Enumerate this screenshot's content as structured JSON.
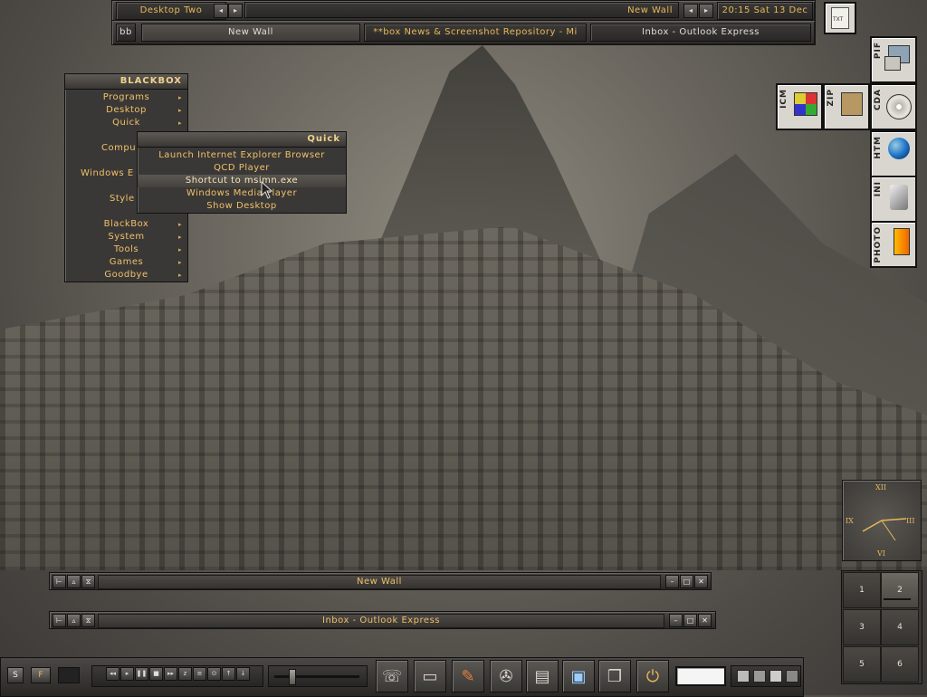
{
  "toolbar": {
    "workspace": "Desktop Two",
    "window": "New Wall",
    "clock": "20:15 Sat 13 Dec"
  },
  "iconbar": {
    "bb": "bb",
    "tasks": [
      "New Wall",
      "**box News & Screenshot Repository - Mi",
      "Inbox - Outlook Express"
    ]
  },
  "root_menu": {
    "title": "BLACKBOX",
    "items": [
      "Programs",
      "Desktop",
      "Quick",
      "",
      "Compu",
      "",
      "Windows E",
      "",
      "Style",
      "",
      "BlackBox",
      "System",
      "Tools",
      "Games",
      "Goodbye"
    ]
  },
  "quick_menu": {
    "title": "Quick",
    "items": [
      "Launch Internet Explorer Browser",
      "QCD Player",
      "Shortcut to msimn.exe",
      "Windows Media Player",
      "Show Desktop"
    ],
    "highlighted": "Shortcut to msimn.exe"
  },
  "windows": [
    {
      "title": "New Wall"
    },
    {
      "title": "Inbox - Outlook Express"
    }
  ],
  "file_icons": [
    {
      "ext": "PIF",
      "name": "pif-file-icon"
    },
    {
      "ext": "ICM",
      "name": "icm-file-icon"
    },
    {
      "ext": "ZIP",
      "name": "zip-file-icon"
    },
    {
      "ext": "CDA",
      "name": "cda-file-icon"
    },
    {
      "ext": "HTM",
      "name": "htm-file-icon"
    },
    {
      "ext": "INI",
      "name": "ini-file-icon"
    },
    {
      "ext": "PHOTO",
      "name": "photo-file-icon"
    }
  ],
  "top_icon": {
    "label": "TXT"
  },
  "clock_face": {
    "xii": "XII",
    "iii": "III",
    "vi": "VI",
    "ix": "IX"
  },
  "pager": {
    "pages": [
      "1",
      "2",
      "3",
      "4",
      "5",
      "6"
    ],
    "current": "2"
  },
  "taskbar": {
    "btn_s": "S",
    "btn_f": "F",
    "media": [
      "◂◂",
      "▸",
      "❚❚",
      "■",
      "▸▸",
      "z",
      "≡",
      "⊙",
      "↑",
      "↓"
    ],
    "volume": 0.18,
    "launchers": [
      "phone-icon",
      "drive-icon",
      "tools-icon",
      "film-reel-icon",
      "folder-icon",
      "monitor-icon",
      "cards-icon",
      "power-icon"
    ]
  },
  "colors": {
    "accent": "#e8b85a",
    "menu_bg": "#3a3836"
  }
}
